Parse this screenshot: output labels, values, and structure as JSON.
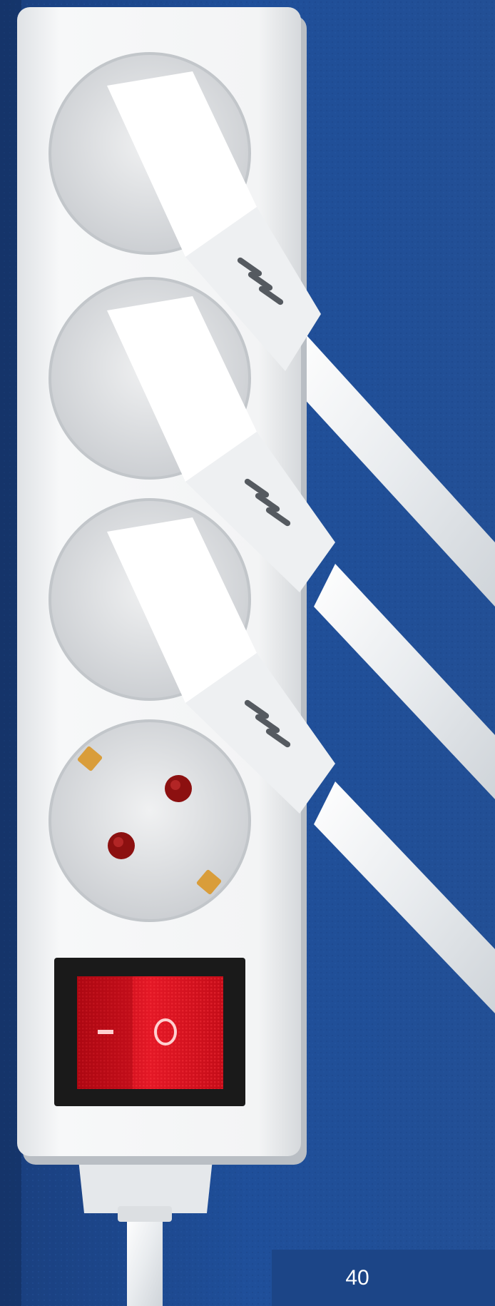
{
  "page": {
    "number": "40"
  },
  "power_strip": {
    "outlets_total": 4,
    "outlets_with_plugs": 3,
    "switch": {
      "labels": [
        "I",
        "O"
      ],
      "color": "#d8101c"
    }
  },
  "colors": {
    "background": "#1f4f9a",
    "strip_body": "#f2f3f4",
    "socket_face": "#e6e7e8",
    "earth_pin_gold": "#d99d3a",
    "hole_red": "#8c1010",
    "page_box": "#1c4587"
  }
}
